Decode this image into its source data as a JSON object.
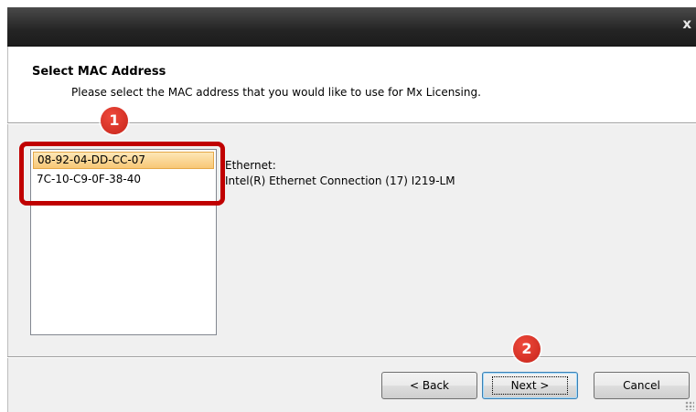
{
  "window": {
    "close_glyph": "x"
  },
  "header": {
    "title": "Select MAC Address",
    "subtitle": "Please select the MAC address that you would like to use for Mx Licensing."
  },
  "mac_list": {
    "items": [
      {
        "label": "08-92-04-DD-CC-07",
        "selected": true
      },
      {
        "label": "7C-10-C9-0F-38-40",
        "selected": false
      }
    ]
  },
  "adapter_info": {
    "type": "Ethernet:",
    "description": "Intel(R) Ethernet Connection (17) I219-LM"
  },
  "annotations": {
    "badge_1": "1",
    "badge_2": "2",
    "highlight_color": "#c00000"
  },
  "buttons": {
    "back": "< Back",
    "next": "Next >",
    "cancel": "Cancel"
  }
}
